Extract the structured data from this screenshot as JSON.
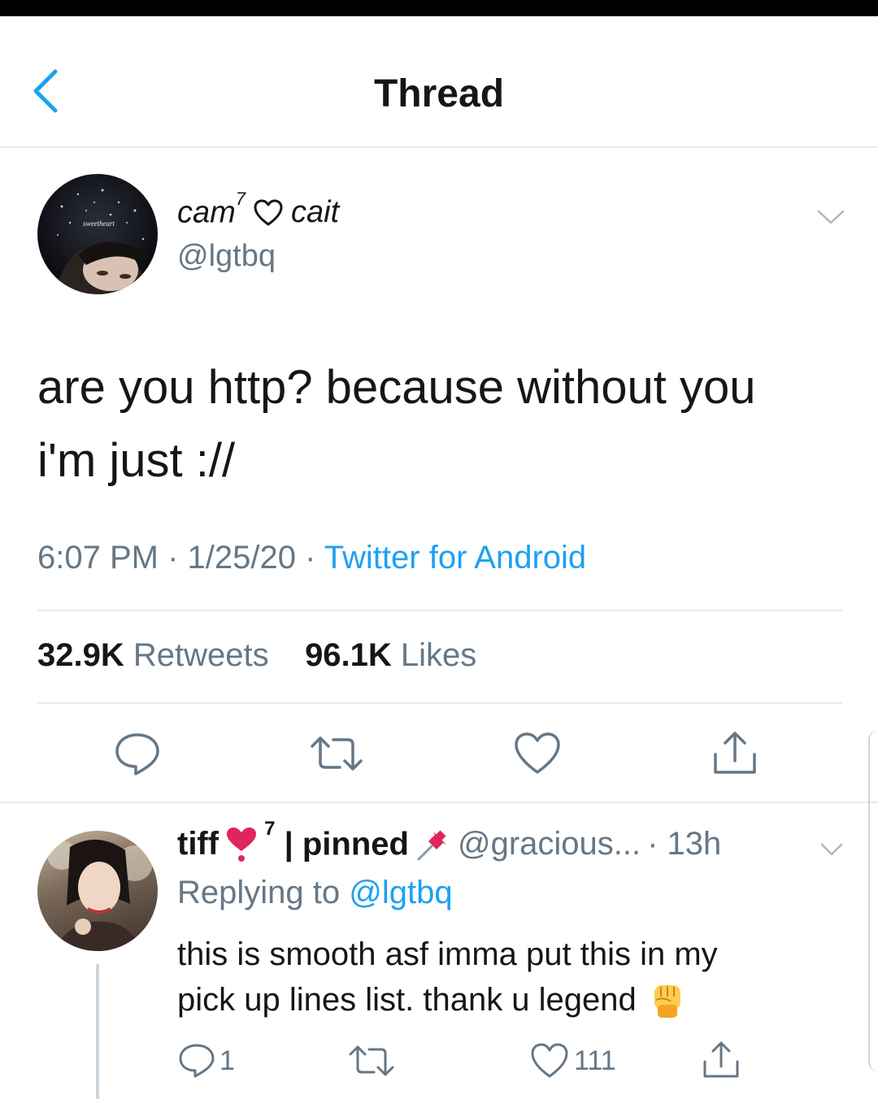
{
  "header": {
    "title": "Thread"
  },
  "tweet": {
    "display_name_left": "cam",
    "display_name_sup": "7",
    "display_name_right": "cait",
    "handle": "@lgtbq",
    "text_line1": "are you http? because without you",
    "text_line2": "i'm just ://",
    "timestamp": "6:07 PM · 1/25/20 · ",
    "source": "Twitter for Android",
    "retweets_count": "32.9K",
    "retweets_label": " Retweets",
    "likes_count": "96.1K",
    "likes_label": " Likes",
    "avatar_text": "sweetheart"
  },
  "reply": {
    "display_name": "tiff",
    "name_sup": "7",
    "name_suffix": "| pinned",
    "handle": "@gracious...",
    "time": "· 13h",
    "replying_prefix": "Replying to ",
    "replying_mention": "@lgtbq",
    "text_line1": "this is smooth asf imma put this in my",
    "text_line2": "pick up lines list. thank u legend",
    "reply_count": "1",
    "like_count": "111"
  },
  "colors": {
    "accent": "#1da1f2",
    "secondary_text": "#657786",
    "divider": "#e6ecf0"
  },
  "icons": [
    "back-arrow-icon",
    "heart-outline-icon",
    "chevron-down-icon",
    "reply-icon",
    "retweet-icon",
    "like-icon",
    "share-icon",
    "heart-exclamation-emoji-icon",
    "pushpin-emoji-icon",
    "raised-fist-emoji-icon"
  ]
}
